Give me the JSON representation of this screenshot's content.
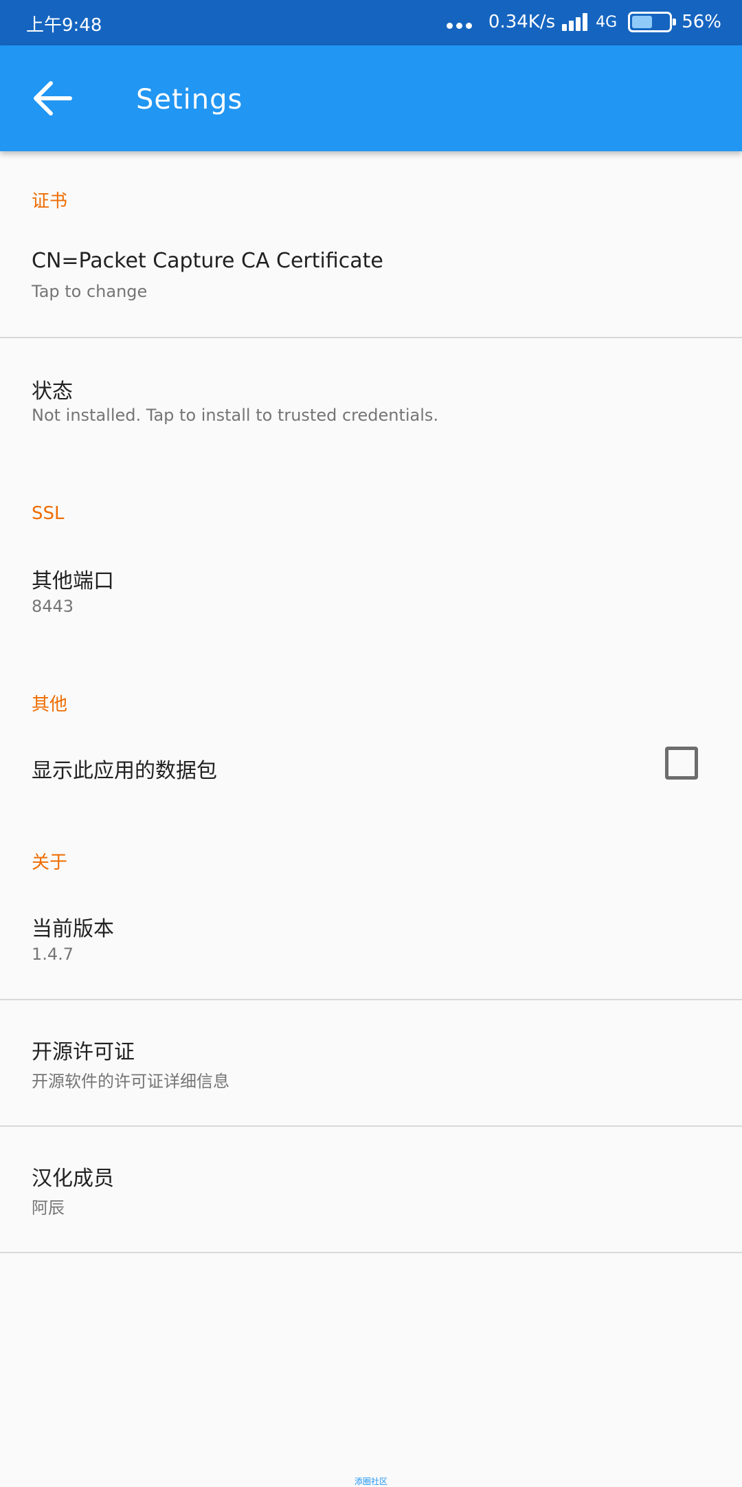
{
  "status_bar": {
    "time": "上午9:48",
    "speed": "0.34K/s",
    "network": "4G",
    "battery": "56%",
    "battery_level": 0.56
  },
  "app_bar": {
    "title": "Setings",
    "back_icon": "arrow-back-icon"
  },
  "sections": {
    "certificate": {
      "header": "证书",
      "cert_title": "CN=Packet Capture CA Certificate",
      "cert_summary": "Tap to change",
      "status_title": "状态",
      "status_summary": "Not installed. Tap to install to trusted credentials."
    },
    "ssl": {
      "header": "SSL",
      "port_title": "其他端口",
      "port_value": "8443"
    },
    "other": {
      "header": "其他",
      "show_packets_title": "显示此应用的数据包",
      "show_packets_checked": false
    },
    "about": {
      "header": "关于",
      "version_title": "当前版本",
      "version_value": "1.4.7",
      "license_title": "开源许可证",
      "license_summary": "开源软件的许可证详细信息",
      "translator_title": "汉化成员",
      "translator_value": "阿辰"
    }
  },
  "watermark": "添圈社区",
  "colors": {
    "status_bar": "#1565c0",
    "app_bar": "#2196f3",
    "section_header": "#ef6c00",
    "background": "#fafafa"
  }
}
